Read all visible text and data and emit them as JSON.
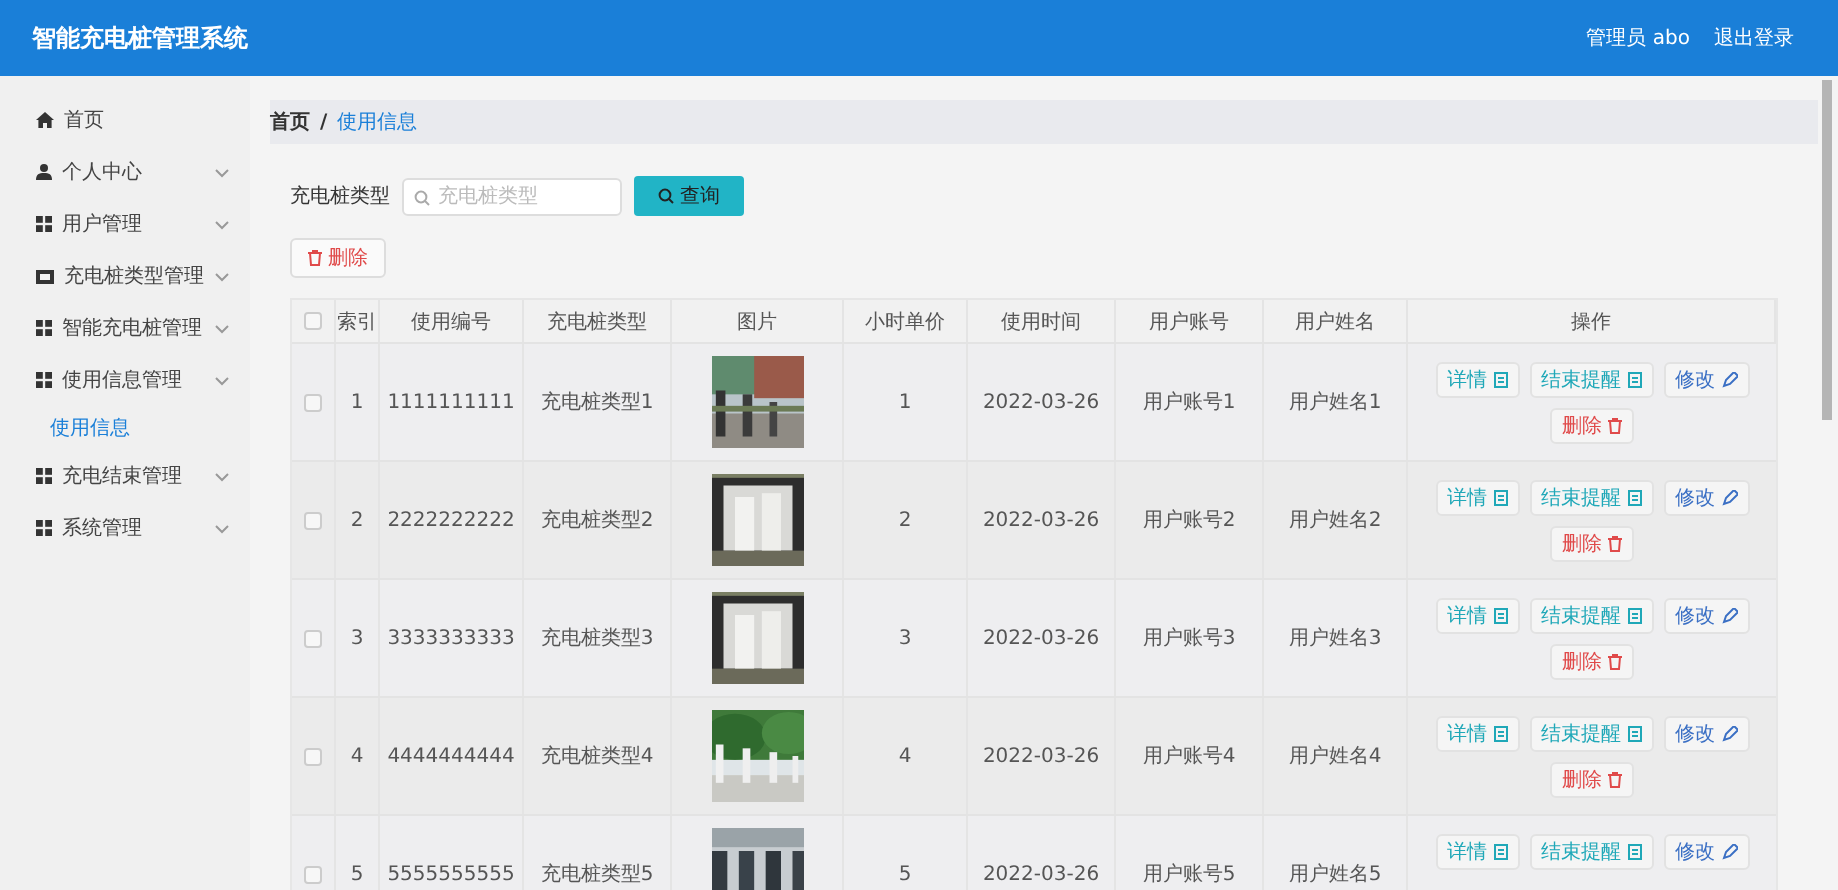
{
  "header": {
    "title": "智能充电桩管理系统",
    "user": "管理员 abo",
    "logout": "退出登录"
  },
  "sidebar": {
    "items": [
      {
        "label": "首页"
      },
      {
        "label": "个人中心",
        "expandable": true
      },
      {
        "label": "用户管理",
        "expandable": true
      },
      {
        "label": "充电桩类型管理",
        "expandable": true
      },
      {
        "label": "智能充电桩管理",
        "expandable": true
      },
      {
        "label": "使用信息管理",
        "expandable": true,
        "children": [
          {
            "label": "使用信息",
            "selected": true
          }
        ]
      },
      {
        "label": "充电结束管理",
        "expandable": true
      },
      {
        "label": "系统管理",
        "expandable": true
      }
    ]
  },
  "breadcrumb": {
    "items": [
      "首页",
      "使用信息"
    ],
    "separator": "/"
  },
  "search": {
    "label": "充电桩类型",
    "placeholder": "充电桩类型",
    "button": "查询"
  },
  "delete_button": "删除",
  "table": {
    "select_all": false,
    "columns": [
      "索引",
      "使用编号",
      "充电桩类型",
      "图片",
      "小时单价",
      "使用时间",
      "用户账号",
      "用户姓名",
      "操作"
    ],
    "rows": [
      {
        "checked": false,
        "index": "1",
        "code": "1111111111",
        "type": "充电桩类型1",
        "price": "1",
        "time": "2022-03-26",
        "account": "用户账号1",
        "name": "用户姓名1",
        "actions": [
          {
            "kind": "detail",
            "label": "详情"
          },
          {
            "kind": "remind",
            "label": "结束提醒"
          },
          {
            "kind": "edit",
            "label": "修改"
          },
          {
            "kind": "delete",
            "label": "删除"
          }
        ]
      },
      {
        "checked": false,
        "index": "2",
        "code": "2222222222",
        "type": "充电桩类型2",
        "price": "2",
        "time": "2022-03-26",
        "account": "用户账号2",
        "name": "用户姓名2",
        "actions": [
          {
            "kind": "detail",
            "label": "详情"
          },
          {
            "kind": "remind",
            "label": "结束提醒"
          },
          {
            "kind": "edit",
            "label": "修改"
          },
          {
            "kind": "delete",
            "label": "删除"
          }
        ]
      },
      {
        "checked": false,
        "index": "3",
        "code": "3333333333",
        "type": "充电桩类型3",
        "price": "3",
        "time": "2022-03-26",
        "account": "用户账号3",
        "name": "用户姓名3",
        "actions": [
          {
            "kind": "detail",
            "label": "详情"
          },
          {
            "kind": "remind",
            "label": "结束提醒"
          },
          {
            "kind": "edit",
            "label": "修改"
          },
          {
            "kind": "delete",
            "label": "删除"
          }
        ]
      },
      {
        "checked": false,
        "index": "4",
        "code": "4444444444",
        "type": "充电桩类型4",
        "price": "4",
        "time": "2022-03-26",
        "account": "用户账号4",
        "name": "用户姓名4",
        "actions": [
          {
            "kind": "detail",
            "label": "详情"
          },
          {
            "kind": "remind",
            "label": "结束提醒"
          },
          {
            "kind": "edit",
            "label": "修改"
          },
          {
            "kind": "delete",
            "label": "删除"
          }
        ]
      },
      {
        "checked": false,
        "index": "5",
        "code": "5555555555",
        "type": "充电桩类型5",
        "price": "5",
        "time": "2022-03-26",
        "account": "用户账号5",
        "name": "用户姓名5",
        "actions": [
          {
            "kind": "detail",
            "label": "详情"
          },
          {
            "kind": "remind",
            "label": "结束提醒"
          },
          {
            "kind": "edit",
            "label": "修改"
          }
        ]
      }
    ]
  }
}
